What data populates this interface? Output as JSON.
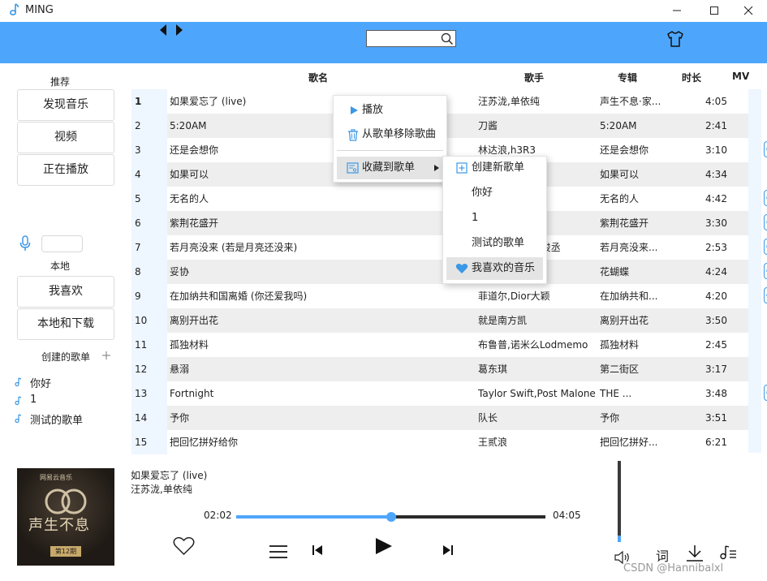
{
  "window": {
    "title": "MING"
  },
  "sidebar": {
    "recommend_heading": "推荐",
    "recommend_items": [
      "发现音乐",
      "视频",
      "正在播放"
    ],
    "local_heading": "本地",
    "local_items": [
      "我喜欢",
      "本地和下载"
    ],
    "created_heading": "创建的歌单",
    "playlists": [
      "你好",
      "1",
      "测试的歌单"
    ]
  },
  "table": {
    "headers": {
      "title": "歌名",
      "artist": "歌手",
      "album": "专辑",
      "duration": "时长",
      "mv": "MV"
    },
    "rows": [
      {
        "num": "1",
        "title": "如果爱忘了 (live)",
        "artist": "汪苏泷,单依纯",
        "album": "声生不息·家...",
        "duration": "4:05",
        "mv": false
      },
      {
        "num": "2",
        "title": "5:20AM",
        "artist": "刀酱",
        "album": "5:20AM",
        "duration": "2:41",
        "mv": false
      },
      {
        "num": "3",
        "title": "还是会想你",
        "artist": "林达浪,h3R3",
        "album": "还是会想你",
        "duration": "3:10",
        "mv": true
      },
      {
        "num": "4",
        "title": "如果可以",
        "artist": "",
        "album": "如果可以",
        "duration": "4:34",
        "mv": false
      },
      {
        "num": "5",
        "title": "无名的人",
        "artist": "",
        "album": "无名的人",
        "duration": "4:42",
        "mv": true
      },
      {
        "num": "6",
        "title": "紫荆花盛开",
        "artist": "",
        "album": "紫荆花盛开",
        "duration": "3:30",
        "mv": true
      },
      {
        "num": "7",
        "title": "若月亮没来 (若是月亮还没来)",
        "artist": "王宇宙Leto,乔浚丞",
        "album": "若月亮没来...",
        "duration": "2:53",
        "mv": true
      },
      {
        "num": "8",
        "title": "妥协",
        "artist": "",
        "album": "花蝴蝶",
        "duration": "4:24",
        "mv": true
      },
      {
        "num": "9",
        "title": "在加纳共和国离婚 (你还爱我吗)",
        "artist": "菲道尔,Dior大颖",
        "album": "在加纳共和...",
        "duration": "4:20",
        "mv": true
      },
      {
        "num": "10",
        "title": "离别开出花",
        "artist": "就是南方凯",
        "album": "离别开出花",
        "duration": "3:50",
        "mv": false
      },
      {
        "num": "11",
        "title": "孤独材料",
        "artist": "布鲁普,诺米么Lodmemo",
        "album": "孤独材料",
        "duration": "2:45",
        "mv": false
      },
      {
        "num": "12",
        "title": "悬溺",
        "artist": "葛东琪",
        "album": "第二街区",
        "duration": "3:17",
        "mv": false
      },
      {
        "num": "13",
        "title": "Fortnight",
        "artist": "Taylor Swift,Post Malone",
        "album": "THE ...",
        "duration": "3:48",
        "mv": true
      },
      {
        "num": "14",
        "title": "予你",
        "artist": "队长",
        "album": "予你",
        "duration": "3:51",
        "mv": false
      },
      {
        "num": "15",
        "title": "把回忆拼好给你",
        "artist": "王贰浪",
        "album": "把回忆拼好...",
        "duration": "6:21",
        "mv": false
      }
    ],
    "mv_label": "MV"
  },
  "context_menu": {
    "items": [
      "播放",
      "从歌单移除歌曲",
      "收藏到歌单"
    ],
    "submenu": [
      "创建新歌单",
      "你好",
      "1",
      "测试的歌单",
      "我喜欢的音乐"
    ]
  },
  "player": {
    "title": "如果爱忘了 (live)",
    "artist": "汪苏泷,单依纯",
    "elapsed": "02:02",
    "total": "04:05",
    "progress": 0.5,
    "volume": 0.08,
    "lyrics_label": "词",
    "cover": {
      "brand": "网易云音乐",
      "title": "声生不息",
      "episode": "第12期"
    }
  },
  "watermark": "CSDN @Hannibalxl",
  "colors": {
    "accent": "#4ea6fc",
    "mv": "#3b98e6"
  }
}
